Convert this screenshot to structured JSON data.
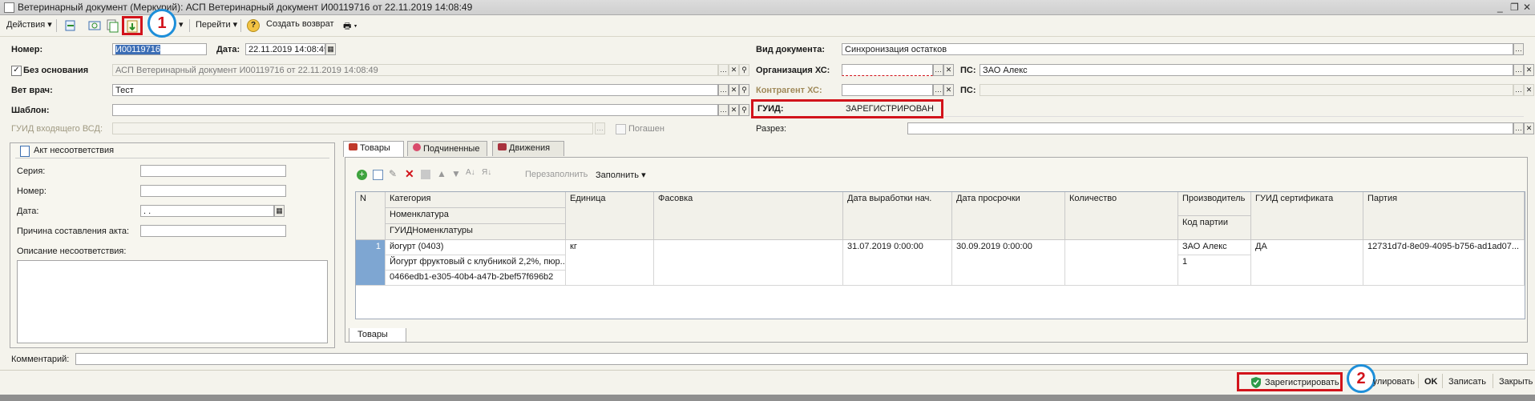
{
  "window": {
    "title": "Ветеринарный документ (Меркурий): АСП Ветеринарный документ И00119716 от 22.11.2019 14:08:49"
  },
  "toolbar": {
    "actions": "Действия",
    "goto": "Перейти",
    "create_return": "Создать возврат"
  },
  "annotations": {
    "badge1": "1",
    "badge2": "2"
  },
  "header": {
    "number_label": "Номер:",
    "number_value": "И00119716",
    "date_label": "Дата:",
    "date_value": "22.11.2019 14:08:49",
    "no_basis_label": "Без основания",
    "no_basis_checked": true,
    "basis_value": "АСП Ветеринарный документ И00119716 от 22.11.2019 14:08:49",
    "vet_label": "Вет врач:",
    "vet_value": "Тест",
    "template_label": "Шаблон:",
    "template_value": "",
    "guid_in_label": "ГУИД входящего ВСД:",
    "guid_in_value": "",
    "repaid_label": "Погашен",
    "doc_kind_label": "Вид документа:",
    "doc_kind_value": "Синхронизация остатков",
    "org_label": "Организация ХС:",
    "org_value": "",
    "ps_label": "ПС:",
    "ps_value": "ЗАО Алекс",
    "counterparty_label": "Контрагент ХС:",
    "counterparty_value": "",
    "ps2_label": "ПС:",
    "ps2_value": "",
    "guid_label": "ГУИД:",
    "guid_value": "ЗАРЕГИСТРИРОВАН",
    "cut_label": "Разрез:",
    "cut_value": ""
  },
  "act": {
    "title": "Акт несоответствия",
    "series_label": "Серия:",
    "number_label": "Номер:",
    "date_label": "Дата:",
    "date_value": " .  .",
    "reason_label": "Причина составления акта:",
    "description_label": "Описание несоответствия:"
  },
  "tabs": {
    "goods": "Товары",
    "subordinate": "Подчиненные",
    "movements": "Движения",
    "bottom_goods": "Товары"
  },
  "table_toolbar": {
    "refill": "Перезаполнить",
    "fill": "Заполнить"
  },
  "table": {
    "headers": {
      "n": "N",
      "category": "Категория",
      "nomenclature": "Номенклатура",
      "guid_nom": "ГУИДНоменклатуры",
      "unit": "Единица",
      "packing": "Фасовка",
      "prod_date": "Дата выработки нач.",
      "exp_date": "Дата просрочки",
      "qty": "Количество",
      "producer": "Производитель",
      "batch_code": "Код партии",
      "cert_guid": "ГУИД сертификата",
      "batch": "Партия"
    },
    "rows": [
      {
        "n": "1",
        "category": "йогурт (0403)",
        "nomenclature": "Йогурт фруктовый с клубникой 2,2%, пюр...",
        "guid_nom": "0466edb1-e305-40b4-a47b-2bef57f696b2",
        "unit": "кг",
        "packing": "",
        "prod_date": "31.07.2019 0:00:00",
        "exp_date": "30.09.2019 0:00:00",
        "qty": "",
        "producer": "ЗАО Алекс",
        "batch_code": "1",
        "cert_guid": "ДА",
        "batch": "12731d7d-8e09-4095-b756-ad1ad07..."
      }
    ]
  },
  "comment_label": "Комментарий:",
  "footer": {
    "register": "Зарегистрировать",
    "cancel": "Аннулировать",
    "ok": "OK",
    "save": "Записать",
    "close": "Закрыть"
  },
  "colors": {
    "annotation_red": "#d2131b",
    "badge_blue": "#1e8fd9",
    "row_marker": "#7ea6d2"
  }
}
